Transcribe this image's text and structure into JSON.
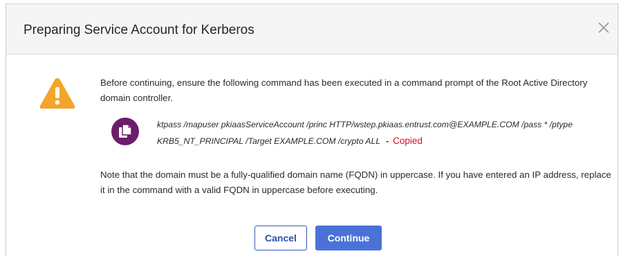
{
  "dialog": {
    "title": "Preparing Service Account for Kerberos",
    "close_icon": "close-icon",
    "warning_icon": "warning-triangle-icon",
    "intro": "Before continuing, ensure the following command has been executed in a command prompt of the Root Active Directory domain controller.",
    "copy_icon": "copy-icon",
    "command": "ktpass /mapuser pkiaasServiceAccount /princ HTTP/wstep.pkiaas.entrust.com@EXAMPLE.COM /pass * /ptype KRB5_NT_PRINCIPAL /Target EXAMPLE.COM /crypto ALL",
    "separator": "-",
    "copied_label": "Copied",
    "note": "Note that the domain must be a fully-qualified domain name (FQDN) in uppercase. If you have entered an IP address, replace it in the command with a valid FQDN in uppercase before executing.",
    "cancel_label": "Cancel",
    "continue_label": "Continue"
  },
  "colors": {
    "header_bg": "#f5f5f6",
    "warning": "#f2a52a",
    "copy_button": "#6b1d6a",
    "copied": "#d0112b",
    "primary": "#4a72d6"
  }
}
